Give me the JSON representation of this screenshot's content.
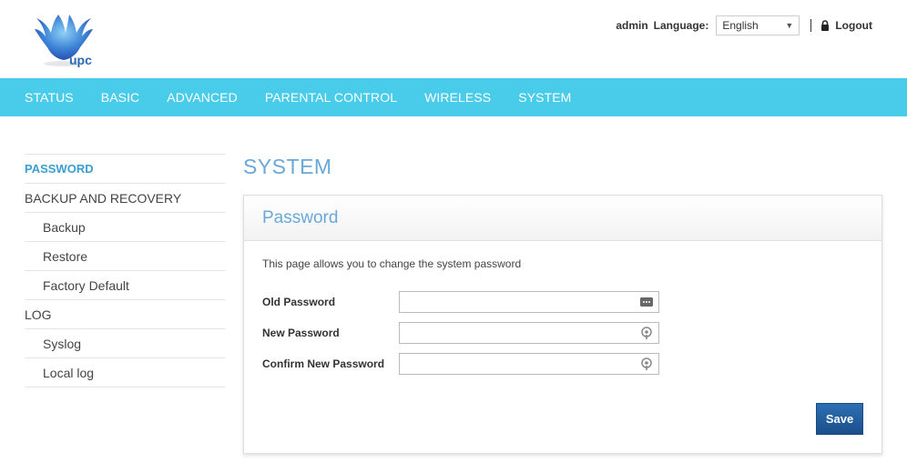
{
  "header": {
    "logo_text": "upc",
    "user": "admin",
    "language_label": "Language:",
    "language_value": "English",
    "logout_label": "Logout"
  },
  "nav": {
    "items": [
      "STATUS",
      "BASIC",
      "ADVANCED",
      "PARENTAL CONTROL",
      "WIRELESS",
      "SYSTEM"
    ]
  },
  "sidebar": {
    "items": [
      {
        "label": "PASSWORD",
        "active": true,
        "sub": false
      },
      {
        "label": "BACKUP AND RECOVERY",
        "active": false,
        "sub": false
      },
      {
        "label": "Backup",
        "active": false,
        "sub": true
      },
      {
        "label": "Restore",
        "active": false,
        "sub": true
      },
      {
        "label": "Factory Default",
        "active": false,
        "sub": true
      },
      {
        "label": "LOG",
        "active": false,
        "sub": false
      },
      {
        "label": "Syslog",
        "active": false,
        "sub": true
      },
      {
        "label": "Local log",
        "active": false,
        "sub": true
      }
    ]
  },
  "main": {
    "page_title": "SYSTEM",
    "panel_title": "Password",
    "description": "This page allows you to change the system password",
    "fields": [
      {
        "label": "Old Password",
        "value": "",
        "icon": "password-dots-icon"
      },
      {
        "label": "New Password",
        "value": "",
        "icon": "key-icon"
      },
      {
        "label": "Confirm New Password",
        "value": "",
        "icon": "key-icon"
      }
    ],
    "save_label": "Save"
  },
  "colors": {
    "nav_bg": "#49cbea",
    "title_blue": "#6aa8d9",
    "active_blue": "#3a9fd0",
    "save_btn": "#1f5a99"
  }
}
